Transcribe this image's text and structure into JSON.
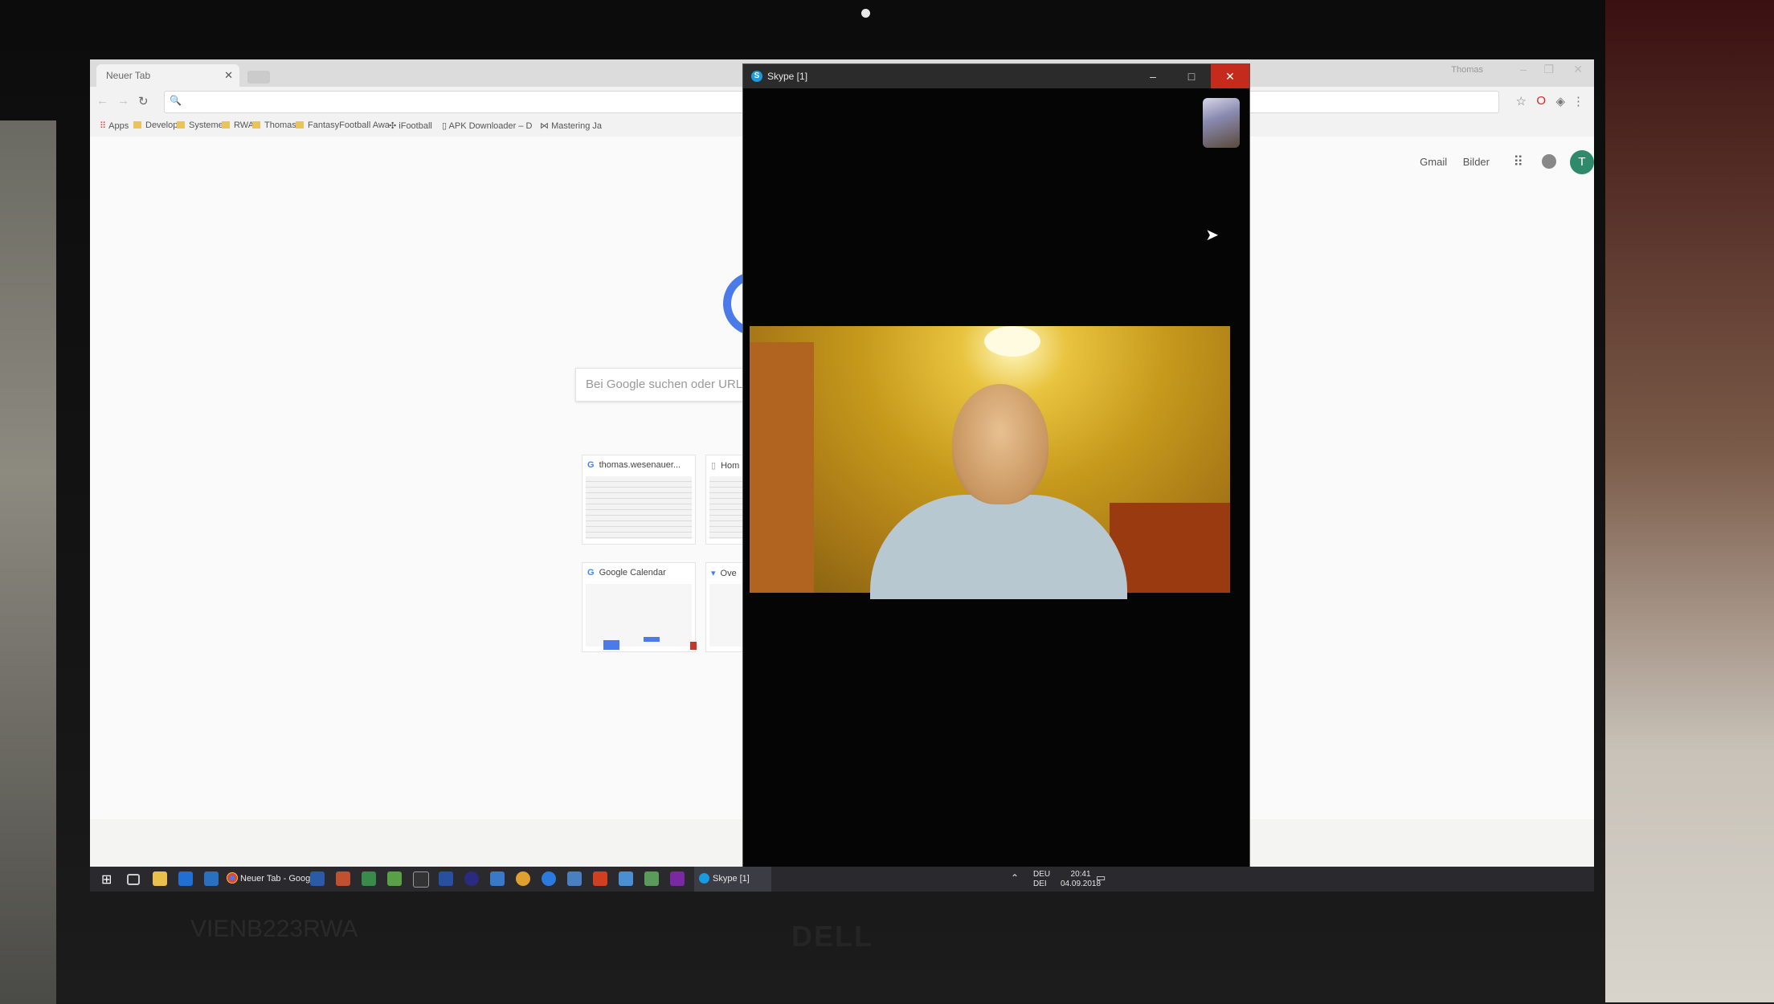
{
  "chrome": {
    "tab_title": "Neuer Tab",
    "tab_close": "✕",
    "user_label": "Thomas",
    "bookmarks": [
      "Apps",
      "Develop",
      "Systeme",
      "RWA",
      "Thomas",
      "FantasyFootball Awa",
      "iFootball",
      "APK Downloader – D",
      "Mastering Ja"
    ],
    "search_placeholder": "Bei Google suchen oder URL",
    "top_links": [
      "Gmail",
      "Bilder"
    ],
    "avatar_letter": "T",
    "tiles": [
      {
        "title": "thomas.wesenauer..."
      },
      {
        "title": "Hom"
      },
      {
        "title": "Google Calendar"
      },
      {
        "title": "Ove"
      }
    ]
  },
  "skype": {
    "title": "Skype [1]",
    "minimize": "–",
    "maximize": "□",
    "close": "✕"
  },
  "taskbar": {
    "chrome_label": "Neuer Tab - Google...",
    "skype_label": "Skype [1]",
    "lang_top": "DEU",
    "lang_bottom": "DEI",
    "time": "20:41",
    "date": "04.09.2018"
  },
  "laptop": {
    "brand": "DELL",
    "asset_tag": "VIENB223RWA"
  },
  "colors": {
    "skype_blue": "#1a9ae0",
    "close_red": "#c42b1c",
    "google_blue": "#4a7be8",
    "avatar_green": "#2e8a6a"
  }
}
